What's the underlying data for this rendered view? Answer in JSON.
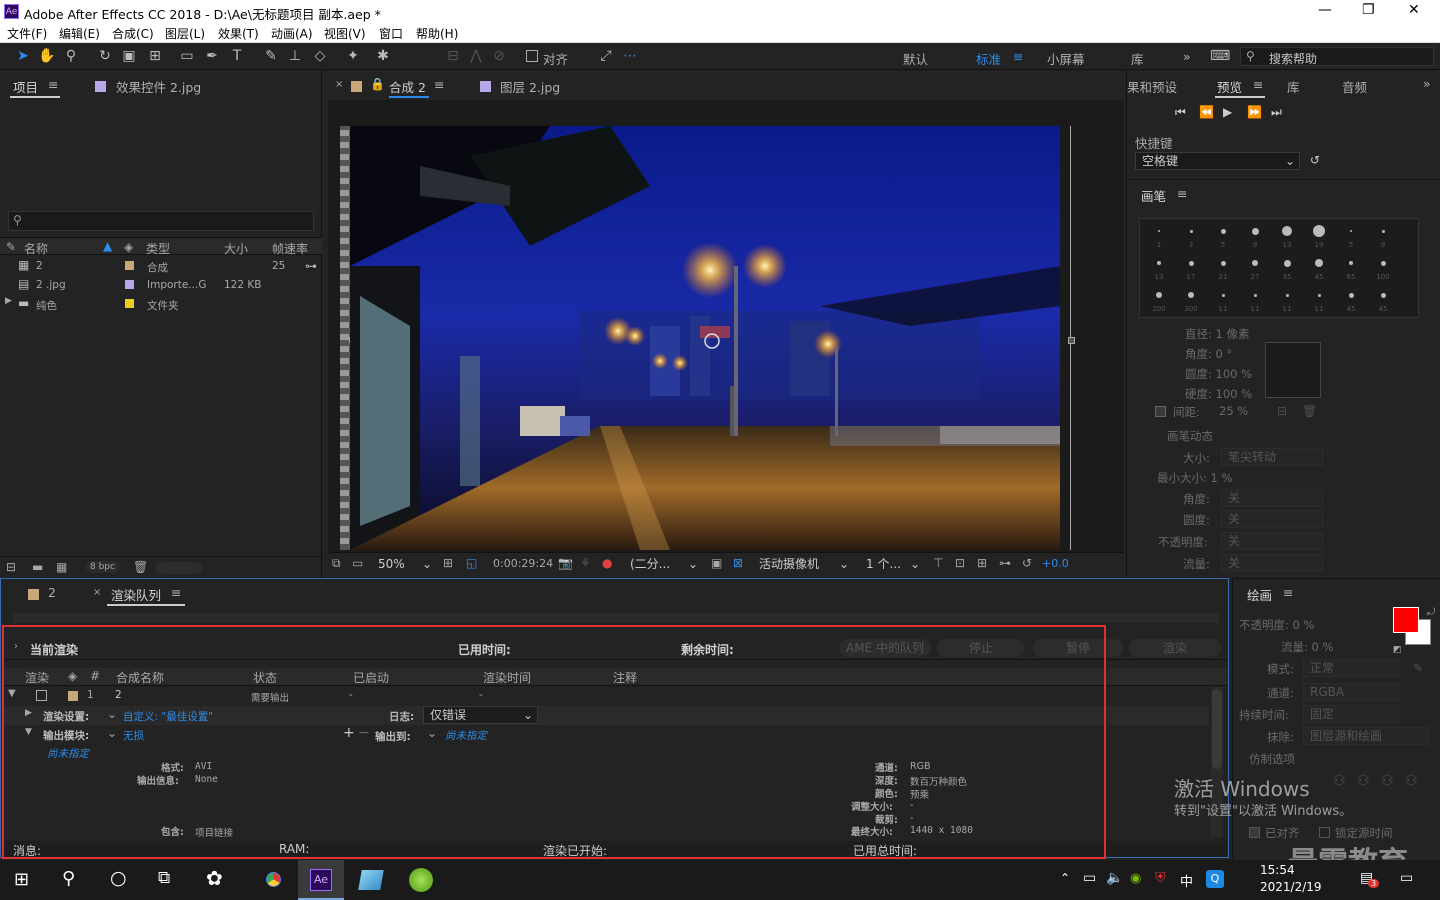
{
  "window": {
    "title": "Adobe After Effects CC 2018 - D:\\Ae\\无标题项目 副本.aep *",
    "app_logo": "Ae",
    "minimize": "—",
    "restore": "❐",
    "close": "✕"
  },
  "menu": [
    "文件(F)",
    "编辑(E)",
    "合成(C)",
    "图层(L)",
    "效果(T)",
    "动画(A)",
    "视图(V)",
    "窗口",
    "帮助(H)"
  ],
  "toolbar": {
    "align_label": "对齐",
    "workspaces": [
      "默认",
      "标准",
      "小屏幕",
      "库"
    ],
    "active_workspace": "标准",
    "more": "»",
    "help_placeholder": "搜索帮助"
  },
  "project_panel": {
    "tab_project": "项目",
    "tab_effects": "效果控件 2.jpg",
    "search_icon": "⚲",
    "columns": {
      "name": "名称",
      "type": "类型",
      "size": "大小",
      "fps": "帧速率"
    },
    "items": [
      {
        "name": "2",
        "type": "合成",
        "size": "",
        "fps": "25",
        "color": "#c8a878"
      },
      {
        "name": "2 .jpg",
        "type": "Importe...G",
        "size": "122 KB",
        "fps": "",
        "color": "#b8a8e8"
      },
      {
        "name": "纯色",
        "type": "文件夹",
        "size": "",
        "fps": "",
        "color": "#e8d020"
      }
    ],
    "bpc": "8 bpc"
  },
  "comp_panel": {
    "tab_comp": "合成 2",
    "tab_layer": "图层 2.jpg",
    "comp_chip": "2",
    "zoom": "50%",
    "timecode": "0:00:29:24",
    "resolution": "(二分...",
    "camera": "活动摄像机",
    "views": "1 个...",
    "exposure": "+0.0"
  },
  "preview_panel": {
    "tabs": [
      "果和预设",
      "预览",
      "库",
      "音频"
    ],
    "active_tab": "预览",
    "shortcut_label": "快捷键",
    "shortcut_value": "空格键"
  },
  "brush_panel": {
    "title": "画笔",
    "sizes_row1": [
      "1",
      "3",
      "5",
      "9",
      "13",
      "19",
      "5",
      "9"
    ],
    "sizes_row2": [
      "13",
      "17",
      "21",
      "27",
      "35",
      "45",
      "65",
      "100"
    ],
    "sizes_row3": [
      "200",
      "300",
      "11",
      "11",
      "11",
      "11",
      "45",
      "45"
    ],
    "diameter": "直径: 1 像素",
    "angle": "角度: 0 °",
    "roundness": "圆度: 100 %",
    "hardness": "硬度: 100 %",
    "spacing_label": "间距:",
    "spacing_value": "25 %",
    "dynamics": "画笔动态",
    "size_label": "大小:",
    "size_value": "笔尖转动",
    "min_size": "最小大小: 1 %",
    "angle2_label": "角度:",
    "round2_label": "圆度:",
    "opacity2_label": "不透明度:",
    "flow2_label": "流量:",
    "off": "关"
  },
  "paint_panel": {
    "title": "绘画",
    "opacity": "不透明度: 0 %",
    "flow": "流量: 0 %",
    "mode_label": "模式:",
    "mode_value": "正常",
    "channel_label": "通道:",
    "channel_value": "RGBA",
    "duration_label": "持续时间:",
    "duration_value": "固定",
    "erase_label": "抹除:",
    "erase_value": "图层源和绘画",
    "clone_options": "仿制选项",
    "aligned": "已对齐",
    "lock_time": "锁定源时间",
    "fg_color": "#ff0000",
    "bg_color": "#ffffff"
  },
  "render_queue": {
    "tab_comp": "2",
    "tab_queue": "渲染队列",
    "current_render": "当前渲染",
    "elapsed": "已用时间:",
    "remaining": "剩余时间:",
    "btn_ame": "AME 中的队列",
    "btn_stop": "停止",
    "btn_pause": "暂停",
    "btn_render": "渲染",
    "columns": {
      "render": "渲染",
      "num": "#",
      "comp": "合成名称",
      "status": "状态",
      "started": "已启动",
      "time": "渲染时间",
      "comment": "注释"
    },
    "item": {
      "num": "1",
      "comp": "2",
      "status": "需要输出",
      "started": "-",
      "time": "-"
    },
    "render_settings_label": "渲染设置:",
    "render_settings_value": "自定义: \"最佳设置\"",
    "log_label": "日志:",
    "log_value": "仅错误",
    "output_module_label": "输出模块:",
    "output_module_value": "无损",
    "output_to_label": "输出到:",
    "output_to_value": "尚未指定",
    "not_specified": "尚未指定",
    "format_label": "格式:",
    "format_value": "AVI",
    "output_info_label": "输出信息:",
    "output_info_value": "None",
    "channel_label": "通道:",
    "channel_value": "RGB",
    "depth_label": "深度:",
    "depth_value": "数百万种颜色",
    "color_label": "颜色:",
    "color_value": "预乘",
    "resize_label": "调整大小:",
    "resize_value": "-",
    "crop_label": "裁剪:",
    "crop_value": "-",
    "final_size_label": "最终大小:",
    "final_size_value": "1440 x 1080",
    "include_label": "包含:",
    "include_value": "项目链接",
    "status_msg": "消息:",
    "status_ram": "RAM:",
    "status_started": "渲染已开始:",
    "status_total": "已用总时间:"
  },
  "watermark": {
    "activate": "激活 Windows",
    "goto": "转到\"设置\"以激活 Windows。",
    "brand": "最需教育"
  },
  "taskbar": {
    "time": "15:54",
    "date": "2021/2/19",
    "ime": "中",
    "badge": "3"
  }
}
